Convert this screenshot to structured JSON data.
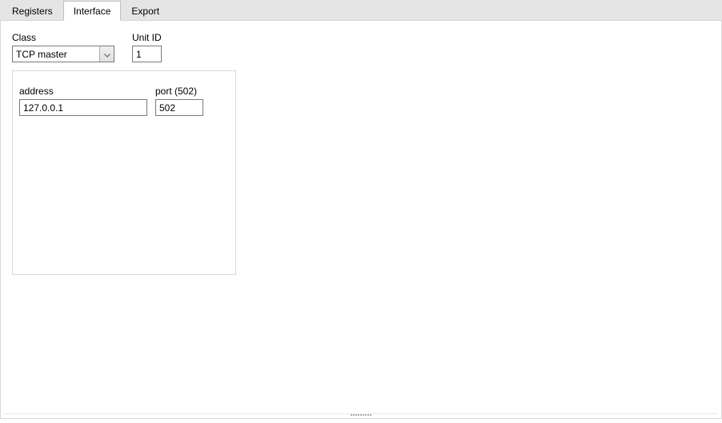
{
  "tabs": {
    "registers": "Registers",
    "interface": "Interface",
    "export": "Export"
  },
  "labels": {
    "class": "Class",
    "unit_id": "Unit ID",
    "address": "address",
    "port": "port (502)"
  },
  "values": {
    "class": "TCP master",
    "unit_id": "1",
    "address": "127.0.0.1",
    "port": "502"
  }
}
